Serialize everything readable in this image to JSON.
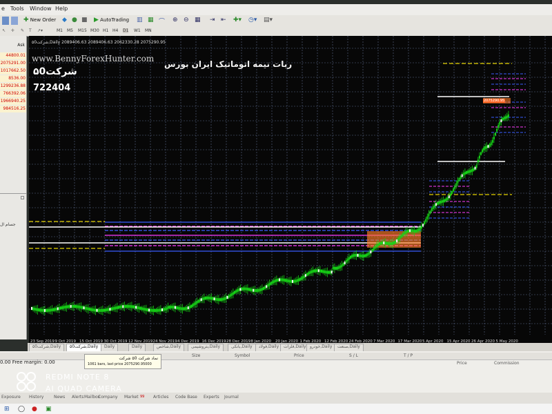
{
  "menu": [
    "e",
    "Tools",
    "Window",
    "Help"
  ],
  "toolbar": {
    "new_order": "New Order",
    "auto_trading": "AutoTrading"
  },
  "timeframes": [
    "M1",
    "M5",
    "M15",
    "M30",
    "H1",
    "H4",
    "D1",
    "W1",
    "MN"
  ],
  "market_watch": {
    "header": "Ask",
    "values": [
      "44800.01",
      "2075291.00",
      "1017662.50",
      "8536.00",
      "1299236.88",
      "766392.06",
      "1966940.25",
      "984516.25"
    ]
  },
  "left_text": "جسام ال",
  "chart": {
    "title_line": "۵0شرکت,Daily 2089406.63 2089406.63 2062330.28 2075290.95",
    "watermark": "www.BennyForexHunter.com",
    "title_fa": "ربات نیمه اتوماتیک ایران بورس",
    "company_label": "۵0شرکت",
    "value_label": "722404",
    "price_label": "2075290.95",
    "date_labels": [
      "23 Sep 2019",
      "9 Oct 2019",
      "15 Oct 2019",
      "30 Oct 2019",
      "12 Nov 2019",
      "24 Nov 2019",
      "4 Dec 2019",
      "16 Dec 2019",
      "28 Dec 2019",
      "8 Jan 2020",
      "20 Jan 2020",
      "1 Feb 2020",
      "12 Feb 2020",
      "24 Feb 2020",
      "7 Mar 2020",
      "17 Mar 2020",
      "5 Apr 2020",
      "15 Apr 2020",
      "26 Apr 2020",
      "5 May 2020"
    ],
    "colors": {
      "bg": "#070707",
      "grid": "#5d6b8c",
      "candle": "#16d316",
      "magenta": "#ff3cff",
      "blue": "#3a5cff",
      "white": "#ffffff",
      "yellow": "#e6d200",
      "orange": "#ff7d28"
    }
  },
  "chart_tabs": [
    "۵0شرکت,Daily",
    "۵0شرکت,Daily",
    "Daily",
    "Daily",
    "شاخص,Daily",
    "بتروشیمی,Daily",
    "بانکی,Daily",
    "فولاد,Daily",
    "فلزات,Daily",
    "خودرو,Daily",
    "صنعت,Daily"
  ],
  "tooltip": {
    "line1": "نماد شرکت ۵0 شرکت",
    "line2": "1061 bars, last price 2075290.95000"
  },
  "terminal": {
    "margin_text": "0.00  Free margin: 0.00",
    "headers": [
      "Size",
      "Symbol",
      "Price",
      "S / L",
      "T / P",
      "Price",
      "Commission"
    ]
  },
  "terminal_tabs": [
    "Exposure",
    "History",
    "News",
    "Alerts",
    "Mailbox",
    "Company",
    "Market",
    "Articles",
    "Code Base",
    "Experts",
    "Journal"
  ],
  "market_badge": "99",
  "phone_watermark": {
    "line1": "REDMI NOTE 8",
    "line2": "AI QUAD CAMERA"
  }
}
